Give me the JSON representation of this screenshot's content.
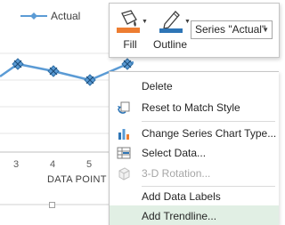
{
  "legend": {
    "label": "Actual",
    "color": "#5b9bd5"
  },
  "x_axis": {
    "title": "DATA POINT",
    "tick_labels": [
      "3",
      "4",
      "5"
    ]
  },
  "mini_toolbar": {
    "fill_label": "Fill",
    "outline_label": "Outline",
    "series_selector_value": "Series \"Actual\"",
    "fill_color": "#ed7d31",
    "outline_color": "#2e75b6"
  },
  "context_menu": {
    "items": [
      {
        "label": "Delete",
        "icon": "none",
        "enabled": true
      },
      {
        "label": "Reset to Match Style",
        "icon": "reset-style-icon",
        "enabled": true
      },
      {
        "label": "Change Series Chart Type...",
        "icon": "chart-type-icon",
        "enabled": true
      },
      {
        "label": "Select Data...",
        "icon": "select-data-icon",
        "enabled": true
      },
      {
        "label": "3-D Rotation...",
        "icon": "rotation-3d-icon",
        "enabled": false
      },
      {
        "label": "Add Data Labels",
        "icon": "none",
        "enabled": true
      },
      {
        "label": "Add Trendline...",
        "icon": "none",
        "enabled": true,
        "highlighted": true
      }
    ]
  }
}
